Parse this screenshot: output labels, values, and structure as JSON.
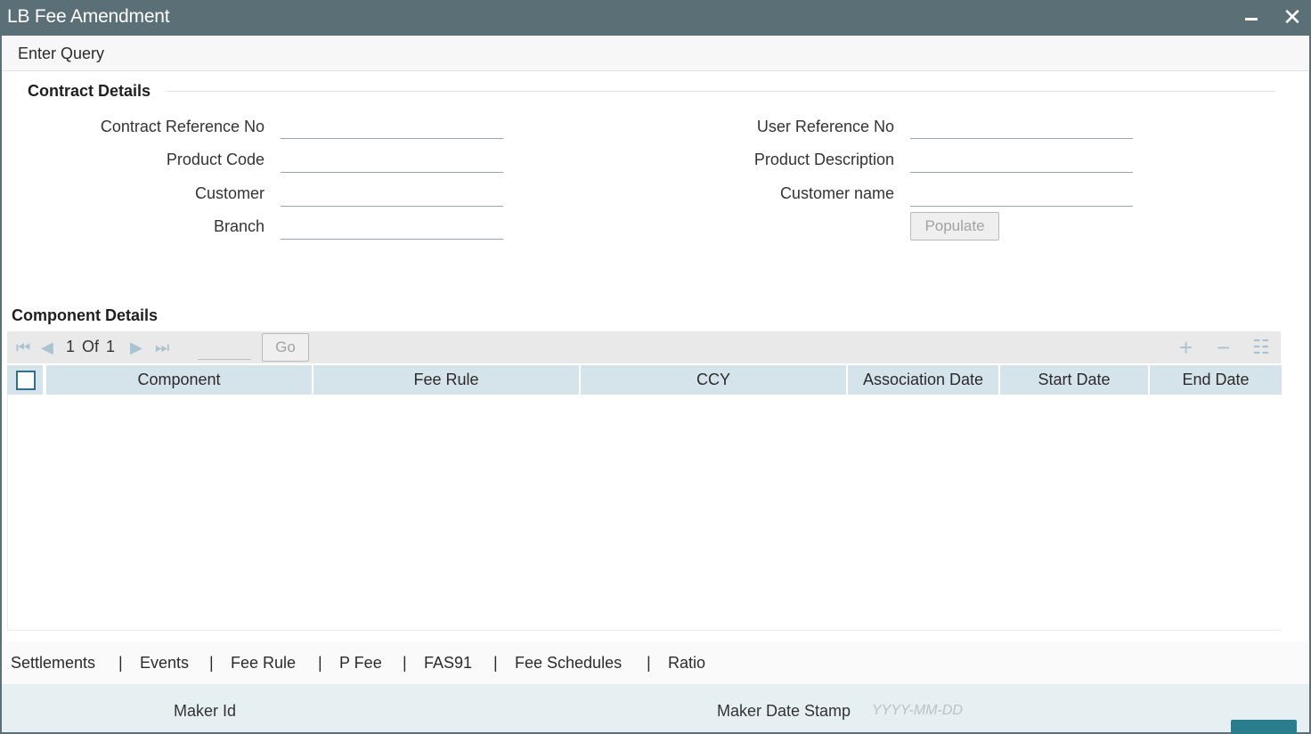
{
  "window": {
    "title": "LB Fee Amendment"
  },
  "menu": {
    "enter_query": "Enter Query"
  },
  "contract_details": {
    "title": "Contract Details",
    "labels": {
      "contract_reference_no": "Contract Reference No",
      "product_code": "Product Code",
      "customer": "Customer",
      "branch": "Branch",
      "user_reference_no": "User Reference No",
      "product_description": "Product Description",
      "customer_name": "Customer name"
    },
    "values": {
      "contract_reference_no": "",
      "product_code": "",
      "customer": "",
      "branch": "",
      "user_reference_no": "",
      "product_description": "",
      "customer_name": ""
    },
    "populate_label": "Populate"
  },
  "component_details": {
    "title": "Component Details",
    "pagination": {
      "current": "1",
      "of_label": "Of",
      "total": "1",
      "go_label": "Go"
    },
    "columns": [
      "Component",
      "Fee Rule",
      "CCY",
      "Association Date",
      "Start Date",
      "End Date"
    ],
    "rows": []
  },
  "bottom_links": [
    "Settlements",
    "Events",
    "Fee Rule",
    "P Fee",
    "FAS91",
    "Fee Schedules",
    "Ratio"
  ],
  "audit": {
    "maker_id_label": "Maker Id",
    "maker_id_value": "",
    "maker_date_label": "Maker Date Stamp",
    "maker_date_placeholder": "YYYY-MM-DD"
  },
  "icons": {
    "minimize": "minimize-icon",
    "close": "close-icon",
    "first_page": "first-page-icon",
    "prev_page": "prev-page-icon",
    "next_page": "next-page-icon",
    "last_page": "last-page-icon",
    "add_row": "add-row-icon",
    "delete_row": "delete-row-icon",
    "single_view": "single-view-icon"
  },
  "colors": {
    "titlebar": "#5b7076",
    "header_cell": "#d5e3ea",
    "accent_icon": "#a9c3d1",
    "exit_button": "#2a7d8d"
  }
}
